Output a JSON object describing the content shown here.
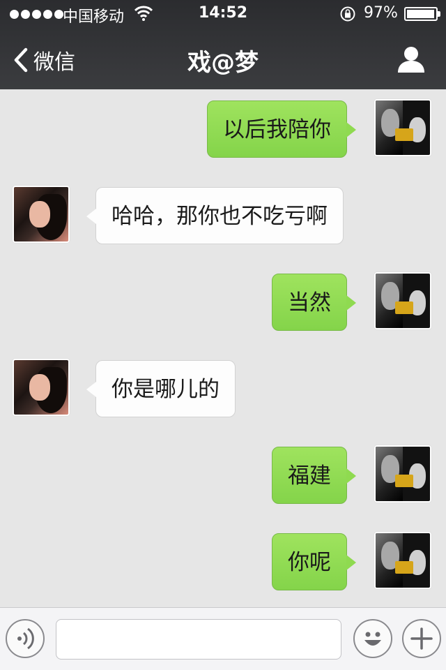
{
  "status_bar": {
    "carrier": "中国移动",
    "time": "14:52",
    "battery": "97%",
    "battery_level": 0.97,
    "signal_dots": 5,
    "icons": [
      "signal-dots-icon",
      "wifi-icon",
      "rotation-lock-icon",
      "battery-icon"
    ]
  },
  "nav": {
    "back_label": "微信",
    "title": "戏@梦",
    "icons": [
      "chevron-left-icon",
      "person-icon"
    ]
  },
  "messages": [
    {
      "from": "self",
      "text": "以后我陪你"
    },
    {
      "from": "peer",
      "text": "哈哈，那你也不吃亏啊"
    },
    {
      "from": "self",
      "text": "当然"
    },
    {
      "from": "peer",
      "text": "你是哪儿的"
    },
    {
      "from": "self",
      "text": "福建"
    },
    {
      "from": "self",
      "text": "你呢"
    }
  ],
  "input_bar": {
    "value": "",
    "icons": [
      "voice-icon",
      "emoji-icon",
      "plus-icon"
    ]
  },
  "colors": {
    "nav_bg": "#2b2c2f",
    "chat_bg": "#e6e6e6",
    "outgoing_bubble": "#8fda50",
    "incoming_bubble": "#fdfdfd"
  }
}
